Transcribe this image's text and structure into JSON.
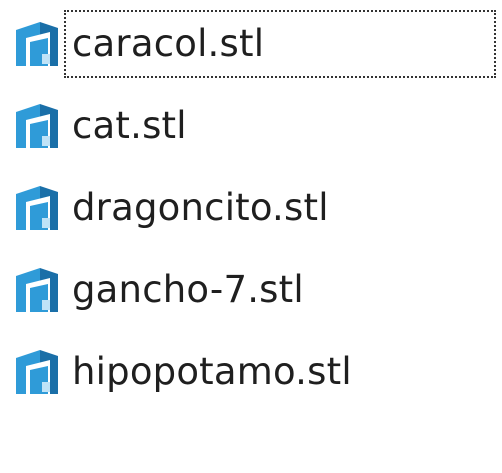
{
  "file_list": {
    "focused_index": 0,
    "icon": "3d-model-file-icon",
    "colors": {
      "icon_primary": "#2f9bd8",
      "icon_dark": "#1a6fa8",
      "icon_label": "#bfe3f7",
      "text": "#1f1f1f"
    },
    "items": [
      {
        "name": "caracol.stl"
      },
      {
        "name": "cat.stl"
      },
      {
        "name": "dragoncito.stl"
      },
      {
        "name": "gancho-7.stl"
      },
      {
        "name": "hipopotamo.stl"
      }
    ]
  }
}
